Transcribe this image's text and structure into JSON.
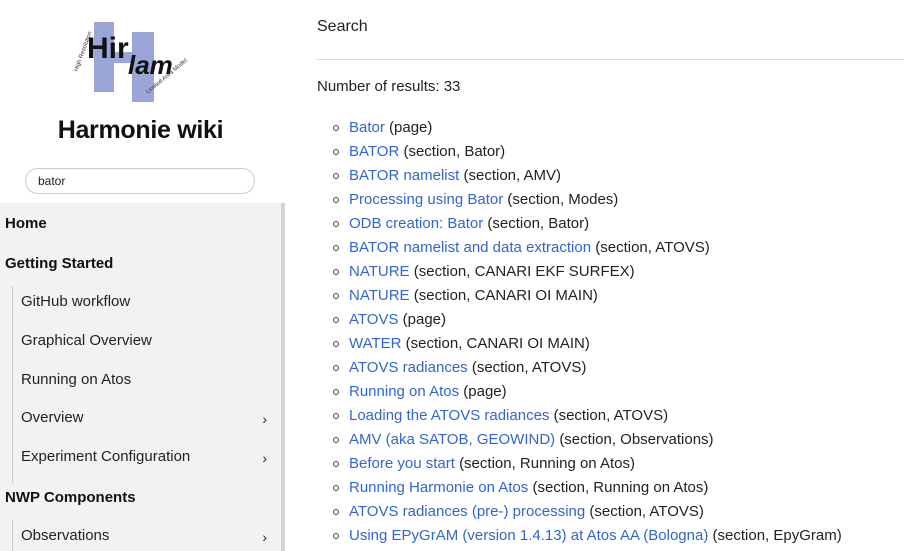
{
  "sidebar": {
    "logo": {
      "top_text": "Hir",
      "bottom_text": "lam",
      "upper_ring": "High Resolution",
      "lower_ring": "Limited Area Model"
    },
    "site_title": "Harmonie wiki",
    "search": {
      "value": "bator"
    },
    "nav": {
      "home": "Home",
      "getting_started": "Getting Started",
      "getting_started_items": [
        "GitHub workflow",
        "Graphical Overview",
        "Running on Atos",
        "Overview",
        "Experiment Configuration"
      ],
      "nwp_components": "NWP Components",
      "nwp_items": [
        "Observations"
      ],
      "chevron": "›"
    }
  },
  "main": {
    "title": "Search",
    "count_text": "Number of results: 33",
    "results": [
      {
        "link": "Bator",
        "meta": "(page)"
      },
      {
        "link": "BATOR",
        "meta": "(section, Bator)"
      },
      {
        "link": "BATOR namelist",
        "meta": "(section, AMV)"
      },
      {
        "link": "Processing using Bator",
        "meta": "(section, Modes)"
      },
      {
        "link": "ODB creation: Bator",
        "meta": "(section, Bator)"
      },
      {
        "link": "BATOR namelist and data extraction",
        "meta": "(section, ATOVS)"
      },
      {
        "link": "NATURE",
        "meta": "(section, CANARI EKF SURFEX)"
      },
      {
        "link": "NATURE",
        "meta": "(section, CANARI OI MAIN)"
      },
      {
        "link": "ATOVS",
        "meta": "(page)"
      },
      {
        "link": "WATER",
        "meta": "(section, CANARI OI MAIN)"
      },
      {
        "link": "ATOVS radiances",
        "meta": "(section, ATOVS)"
      },
      {
        "link": "Running on Atos",
        "meta": "(page)"
      },
      {
        "link": "Loading the ATOVS radiances",
        "meta": "(section, ATOVS)"
      },
      {
        "link": "AMV (aka SATOB, GEOWIND)",
        "meta": "(section, Observations)"
      },
      {
        "link": "Before you start",
        "meta": "(section, Running on Atos)"
      },
      {
        "link": "Running Harmonie on Atos",
        "meta": "(section, Running on Atos)"
      },
      {
        "link": "ATOVS radiances (pre-) processing",
        "meta": "(section, ATOVS)"
      },
      {
        "link": "Using EPyGrAM (version 1.4.13) at Atos AA (Bologna)",
        "meta": "(section, EpyGram)"
      }
    ]
  },
  "colors": {
    "link": "#3366cc",
    "nav_bg": "#f2f2f2",
    "logo_bar": "#9aa6d8"
  }
}
